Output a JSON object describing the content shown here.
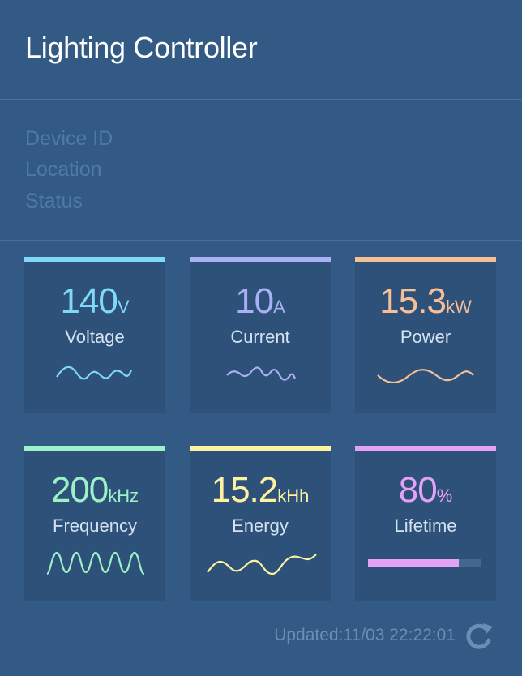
{
  "header": {
    "title": "Lighting Controller"
  },
  "device_info": {
    "labels": [
      "Device ID",
      "Location",
      "Status"
    ]
  },
  "metrics": [
    {
      "value": "140",
      "unit": "V",
      "label": "Voltage",
      "color": "#7fd8f7"
    },
    {
      "value": "10",
      "unit": "A",
      "label": "Current",
      "color": "#a9b0f5"
    },
    {
      "value": "15.3",
      "unit": "kW",
      "label": "Power",
      "color": "#f6bf98"
    },
    {
      "value": "200",
      "unit": "kHz",
      "label": "Frequency",
      "color": "#9cf1c6"
    },
    {
      "value": "15.2",
      "unit": "kHh",
      "label": "Energy",
      "color": "#fdf2a1"
    },
    {
      "value": "80",
      "unit": "%",
      "label": "Lifetime",
      "color": "#e3a2f5",
      "progress": 0.8
    }
  ],
  "footer": {
    "updated_text": "Updated:11/03 22:22:01",
    "refresh_icon": "refresh-icon"
  }
}
